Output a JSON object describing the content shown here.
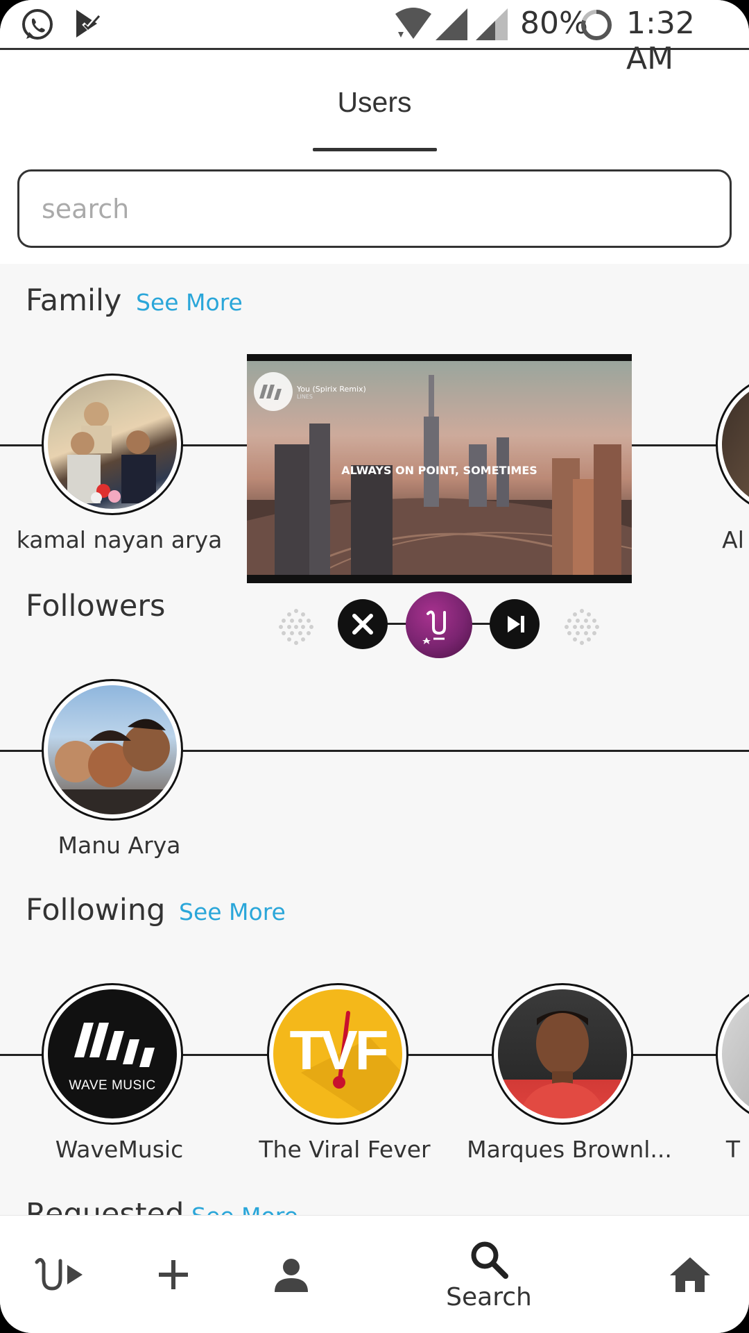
{
  "status_bar": {
    "battery": "80%",
    "time": "1:32 AM",
    "icons": [
      "whatsapp-icon",
      "task-check-icon",
      "wifi-icon",
      "signal-icon",
      "signal-2-icon",
      "battery-ring-icon"
    ]
  },
  "header": {
    "title": "Users"
  },
  "search": {
    "placeholder": "search",
    "value": ""
  },
  "sections": {
    "family": {
      "title": "Family",
      "see_more": "See More",
      "users": [
        {
          "name": "kamal nayan arya"
        },
        {
          "name": "Al"
        }
      ]
    },
    "followers": {
      "title": "Followers",
      "users": [
        {
          "name": "Manu Arya"
        }
      ]
    },
    "following": {
      "title": "Following",
      "see_more": "See More",
      "users": [
        {
          "name": "WaveMusic",
          "logo_text": "WAVE MUSIC"
        },
        {
          "name": "The Viral Fever",
          "logo_text": "TVF"
        },
        {
          "name": "Marques Brownl..."
        },
        {
          "name": "T"
        }
      ]
    },
    "requested": {
      "title": "Requested",
      "see_more": "See More"
    }
  },
  "player": {
    "song": "You (Spirix Remix)",
    "artist": "LINES",
    "caption": "ALWAYS ON POINT, SOMETIMES",
    "controls": [
      "close-icon",
      "app-logo-icon",
      "skip-next-icon"
    ]
  },
  "bottom_nav": {
    "items": [
      {
        "icon": "app-logo-play-icon"
      },
      {
        "icon": "plus-icon"
      },
      {
        "icon": "person-icon"
      },
      {
        "icon": "search-icon",
        "label": "Search",
        "active": true
      },
      {
        "icon": "home-icon"
      }
    ]
  },
  "colors": {
    "accent_link": "#2aa6d9",
    "player_logo": "#7a2470",
    "tvf_yellow": "#f4b81a"
  }
}
